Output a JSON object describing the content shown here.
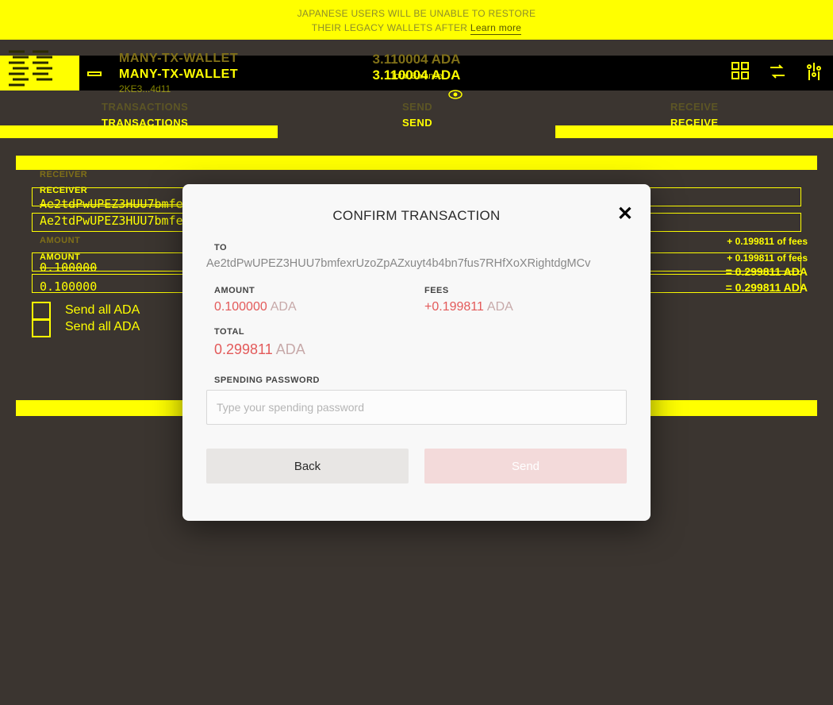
{
  "banner": {
    "line1": "JAPANESE USERS WILL BE UNABLE TO RESTORE",
    "line2_prefix": "THEIR LEGACY WALLETS AFTER ",
    "learn_more": "Learn more"
  },
  "header": {
    "wallet_name": "MANY-TX-WALLET",
    "wallet_sub": "2KE3...4d11",
    "balance": "3.110004 ADA",
    "total_balance_label": "Total Balance"
  },
  "tabs": {
    "transactions": "TRANSACTIONS",
    "send": "SEND",
    "receive": "RECEIVE"
  },
  "form": {
    "receiver_label": "RECEIVER",
    "receiver_value": "Ae2tdPwUPEZ3HUU7bmfe",
    "amount_label": "AMOUNT",
    "amount_value": "0.100000",
    "fees_line": "+ 0.199811 of fees",
    "equals_line": "= 0.299811 ADA",
    "send_all": "Send all ADA"
  },
  "modal": {
    "title": "CONFIRM TRANSACTION",
    "to_label": "TO",
    "to_value": "Ae2tdPwUPEZ3HUU7bmfexrUzoZpAZxuyt4b4bn7fus7RHfXoXRightdgMCv",
    "amount_label": "AMOUNT",
    "amount_value": "0.100000",
    "fees_label": "FEES",
    "fees_value": "+0.199811",
    "total_label": "TOTAL",
    "total_value": "0.299811",
    "currency": "ADA",
    "password_label": "SPENDING PASSWORD",
    "password_placeholder": "Type your spending password",
    "back_button": "Back",
    "send_button": "Send"
  }
}
